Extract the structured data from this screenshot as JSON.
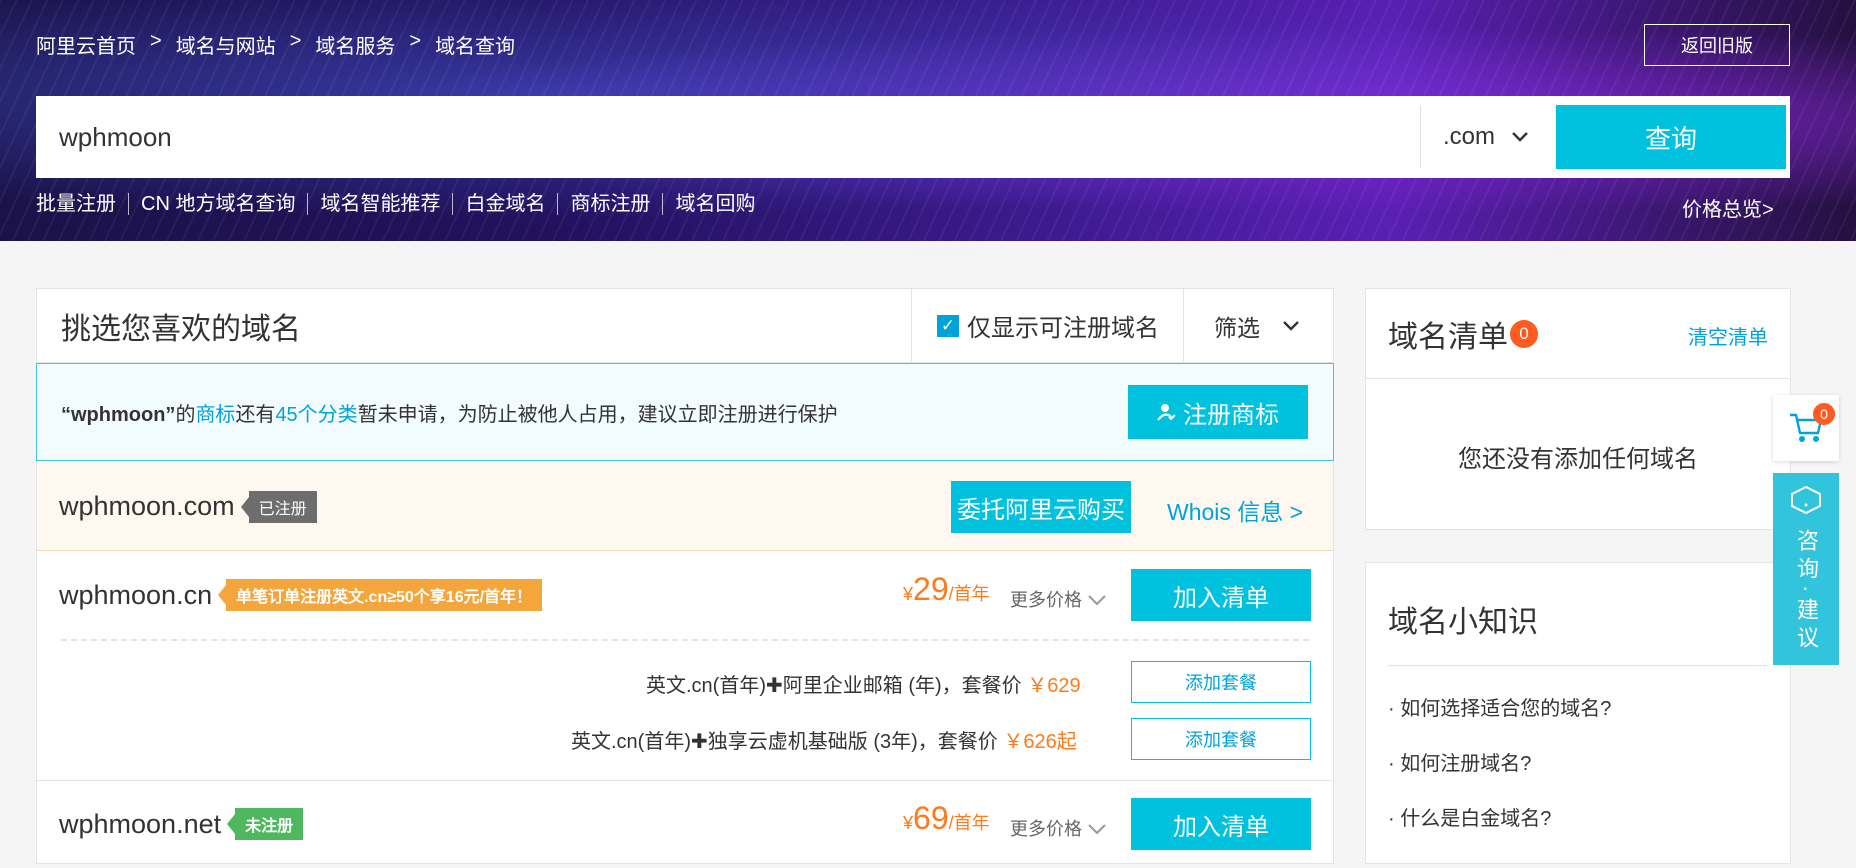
{
  "breadcrumb": [
    "阿里云首页",
    "域名与网站",
    "域名服务",
    "域名查询"
  ],
  "breadcrumb_sep": ">",
  "old_version_btn": "返回旧版",
  "search": {
    "value": "wphmoon",
    "suffix": ".com",
    "query_btn": "查询"
  },
  "quick_links": [
    "批量注册",
    "CN 地方域名查询",
    "域名智能推荐",
    "白金域名",
    "商标注册",
    "域名回购"
  ],
  "price_overview": "价格总览>",
  "panel": {
    "title": "挑选您喜欢的域名",
    "only_available": "仅显示可注册域名",
    "filter": "筛选"
  },
  "notice": {
    "name": "“wphmoon”",
    "t1": "的",
    "link1": "商标",
    "t2": "还有",
    "link2": "45个分类",
    "t3": "暂未申请，为防止被他人占用，建议立即注册进行保护",
    "button": "注册商标"
  },
  "domains": [
    {
      "name": "wphmoon.com",
      "tag": "已注册",
      "entrust_btn": "委托阿里云购买",
      "whois": "Whois 信息 >"
    },
    {
      "name": "wphmoon.cn",
      "tag": "单笔订单注册英文.cn≥50个享16元/首年！",
      "currency": "¥",
      "price": "29",
      "unit": "/首年",
      "more_price": "更多价格",
      "add_btn": "加入清单",
      "packages": [
        {
          "text": "英文.cn(首年)",
          "plus": "✚",
          "text2": "阿里企业邮箱 (年)，套餐价",
          "price": "￥629",
          "btn": "添加套餐"
        },
        {
          "text": "英文.cn(首年)",
          "plus": "✚",
          "text2": "独享云虚机基础版 (3年)，套餐价",
          "price": "￥626起",
          "btn": "添加套餐"
        }
      ]
    },
    {
      "name": "wphmoon.net",
      "tag": "未注册",
      "currency": "¥",
      "price": "69",
      "unit": "/首年",
      "more_price": "更多价格",
      "add_btn": "加入清单"
    }
  ],
  "cart_panel": {
    "title": "域名清单",
    "count": "0",
    "clear": "清空清单",
    "empty": "您还没有添加任何域名"
  },
  "knowledge": {
    "title": "域名小知识",
    "tips": [
      "· 如何选择适合您的域名?",
      "· 如何注册域名?",
      "· 什么是白金域名?"
    ]
  },
  "float": {
    "cart_count": "0",
    "consult": "咨询·建议"
  },
  "colors": {
    "accent": "#00c1de",
    "price": "#ff7a1a",
    "badge": "#ff5a1f"
  }
}
